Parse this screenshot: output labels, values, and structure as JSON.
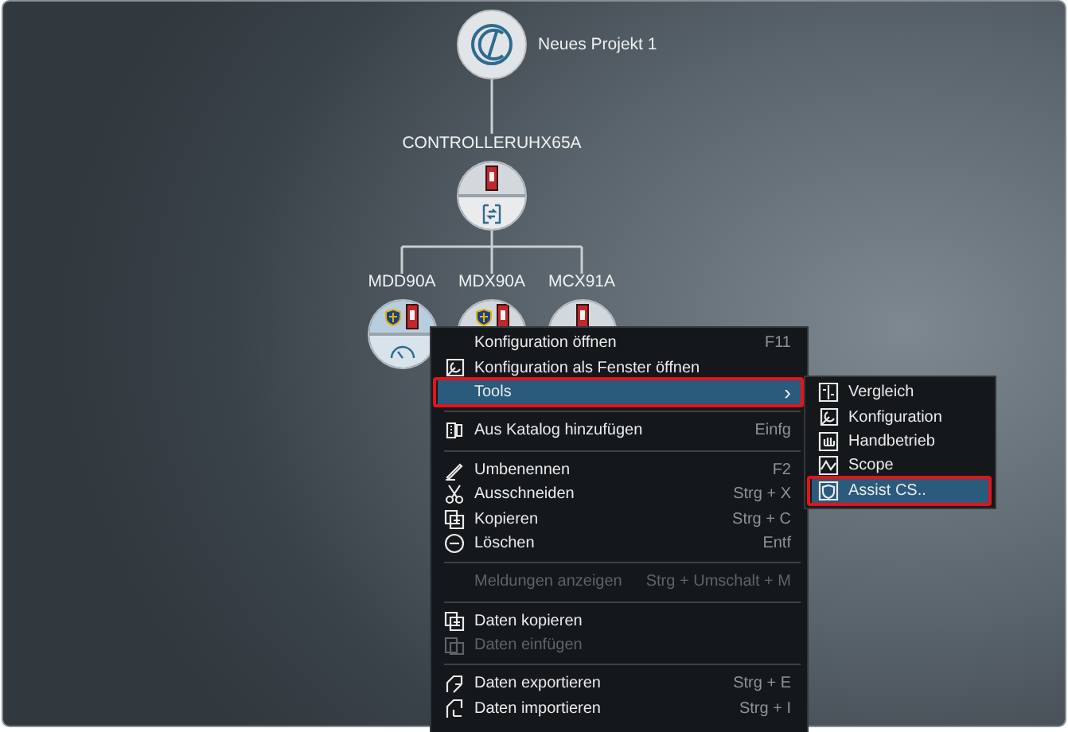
{
  "project": {
    "label": "Neues Projekt 1",
    "kind": "project",
    "selected": false,
    "children": [
      {
        "label": "CONTROLLERUHX65A",
        "kind": "controller",
        "selected": false,
        "children": [
          {
            "label": "MDD90A",
            "kind": "drive",
            "selected": true,
            "safety": true
          },
          {
            "label": "MDX90A",
            "kind": "drive",
            "selected": false,
            "safety": true
          },
          {
            "label": "MCX91A",
            "kind": "drive",
            "selected": false,
            "safety": false
          }
        ]
      }
    ]
  },
  "context_menu": {
    "items": [
      {
        "kind": "item",
        "label": "Konfiguration öffnen",
        "shortcut": "F11",
        "disabled": false,
        "selected": false,
        "outlined": false
      },
      {
        "kind": "item",
        "label": "Konfiguration als Fenster öffnen",
        "disabled": false,
        "selected": false,
        "outlined": false
      },
      {
        "kind": "submenu",
        "label": "Tools",
        "arrow": "›",
        "disabled": false,
        "selected": true,
        "outlined": true
      },
      {
        "kind": "separator"
      },
      {
        "kind": "item",
        "label": "Aus Katalog hinzufügen",
        "shortcut": "Einfg",
        "disabled": false,
        "selected": false,
        "outlined": false
      },
      {
        "kind": "separator"
      },
      {
        "kind": "item",
        "label": "Umbenennen",
        "shortcut": "F2",
        "disabled": false,
        "selected": false,
        "outlined": false
      },
      {
        "kind": "item",
        "label": "Ausschneiden",
        "shortcut": "Strg + X",
        "disabled": false,
        "selected": false,
        "outlined": false
      },
      {
        "kind": "item",
        "label": "Kopieren",
        "shortcut": "Strg + C",
        "disabled": false,
        "selected": false,
        "outlined": false
      },
      {
        "kind": "item",
        "label": "Löschen",
        "shortcut": "Entf",
        "disabled": false,
        "selected": false,
        "outlined": false
      },
      {
        "kind": "separator"
      },
      {
        "kind": "item",
        "label": "Meldungen anzeigen",
        "shortcut": "Strg + Umschalt + M",
        "disabled": true,
        "selected": false,
        "outlined": false
      },
      {
        "kind": "separator"
      },
      {
        "kind": "item",
        "label": "Daten kopieren",
        "disabled": false,
        "selected": false,
        "outlined": false
      },
      {
        "kind": "item",
        "label": "Daten einfügen",
        "disabled": true,
        "selected": false,
        "outlined": false
      },
      {
        "kind": "separator"
      },
      {
        "kind": "item",
        "label": "Daten exportieren",
        "shortcut": "Strg + E",
        "disabled": false,
        "selected": false,
        "outlined": false
      },
      {
        "kind": "item",
        "label": "Daten importieren",
        "shortcut": "Strg + I",
        "disabled": false,
        "selected": false,
        "outlined": false
      }
    ]
  },
  "submenu": {
    "items": [
      {
        "label": "Vergleich",
        "selected": false,
        "outlined": false
      },
      {
        "label": "Konfiguration",
        "selected": false,
        "outlined": false
      },
      {
        "label": "Handbetrieb",
        "selected": false,
        "outlined": false
      },
      {
        "label": "Scope",
        "selected": false,
        "outlined": false
      },
      {
        "label": "Assist CS..",
        "selected": true,
        "outlined": true
      }
    ]
  }
}
